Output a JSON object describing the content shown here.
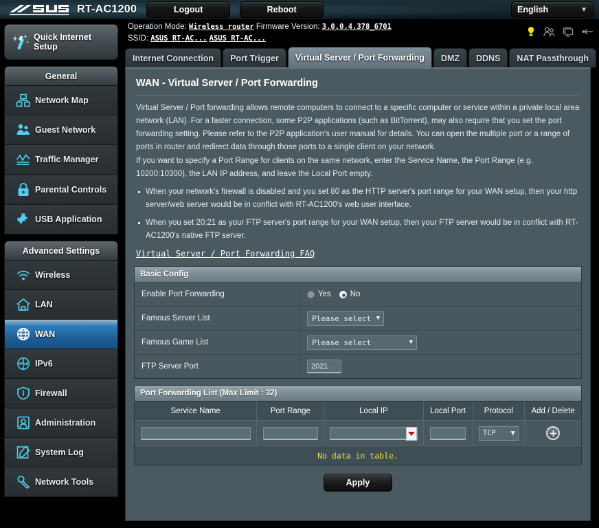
{
  "header": {
    "brand": "ASUS",
    "model": "RT-AC1200",
    "logout_label": "Logout",
    "reboot_label": "Reboot",
    "language": "English",
    "caret": "▼"
  },
  "status": {
    "operation_mode_label": "Operation Mode:",
    "operation_mode_value": "Wireless router",
    "firmware_label": "Firmware Version:",
    "firmware_value": "3.0.0.4.378_6701",
    "ssid_label": "SSID:",
    "ssid_1": "ASUS RT-AC...",
    "ssid_2": "ASUS RT-AC...",
    "icons": [
      "alert-icon",
      "clients-icon",
      "monitor-icon",
      "usb-icon"
    ]
  },
  "sidebar": {
    "quick_setup": "Quick Internet Setup",
    "groups": [
      {
        "title": "General",
        "items": [
          {
            "label": "Network Map",
            "icon": "network-map-icon",
            "active": false
          },
          {
            "label": "Guest Network",
            "icon": "guest-network-icon",
            "active": false
          },
          {
            "label": "Traffic Manager",
            "icon": "traffic-manager-icon",
            "active": false
          },
          {
            "label": "Parental Controls",
            "icon": "parental-controls-icon",
            "active": false
          },
          {
            "label": "USB Application",
            "icon": "usb-application-icon",
            "active": false
          }
        ]
      },
      {
        "title": "Advanced Settings",
        "items": [
          {
            "label": "Wireless",
            "icon": "wireless-icon",
            "active": false
          },
          {
            "label": "LAN",
            "icon": "lan-icon",
            "active": false
          },
          {
            "label": "WAN",
            "icon": "wan-icon",
            "active": true
          },
          {
            "label": "IPv6",
            "icon": "ipv6-icon",
            "active": false
          },
          {
            "label": "Firewall",
            "icon": "firewall-icon",
            "active": false
          },
          {
            "label": "Administration",
            "icon": "administration-icon",
            "active": false
          },
          {
            "label": "System Log",
            "icon": "system-log-icon",
            "active": false
          },
          {
            "label": "Network Tools",
            "icon": "network-tools-icon",
            "active": false
          }
        ]
      }
    ]
  },
  "tabs": [
    {
      "label": "Internet Connection",
      "active": false
    },
    {
      "label": "Port Trigger",
      "active": false
    },
    {
      "label": "Virtual Server / Port Forwarding",
      "active": true
    },
    {
      "label": "DMZ",
      "active": false
    },
    {
      "label": "DDNS",
      "active": false
    },
    {
      "label": "NAT Passthrough",
      "active": false
    }
  ],
  "page": {
    "title": "WAN - Virtual Server / Port Forwarding",
    "desc_p1": "Virtual Server / Port forwarding allows remote computers to connect to a specific computer or service within a private local area network (LAN). For a faster connection, some P2P applications (such as BitTorrent), may also require that you set the port forwarding setting. Please refer to the P2P application's user manual for details. You can open the multiple port or a range of ports in router and redirect data through those ports to a single client on your network.",
    "desc_p2": "If you want to specify a Port Range for clients on the same network, enter the Service Name, the Port Range (e.g. 10200:10300), the LAN IP address, and leave the Local Port empty.",
    "bullet_1": "When your network's firewall is disabled and you set 80 as the HTTP server's port range for your WAN setup, then your http server/web server would be in conflict with RT-AC1200's web user interface.",
    "bullet_2": "When you set 20:21 as your FTP server's port range for your WAN setup, then your FTP server would be in conflict with RT-AC1200's native FTP server.",
    "faq_link": "Virtual Server / Port Forwarding FAQ"
  },
  "basic_config": {
    "section_title": "Basic Config",
    "enable_label": "Enable Port Forwarding",
    "yes_label": "Yes",
    "no_label": "No",
    "enable_selected": "No",
    "famous_server_label": "Famous Server List",
    "famous_server_value": "Please select",
    "famous_game_label": "Famous Game List",
    "famous_game_value": "Please select",
    "ftp_port_label": "FTP Server Port",
    "ftp_port_value": "2021",
    "caret": "▼"
  },
  "port_forwarding_list": {
    "section_title": "Port Forwarding List (Max Limit : 32)",
    "columns": [
      "Service Name",
      "Port Range",
      "Local IP",
      "Local Port",
      "Protocol",
      "Add / Delete"
    ],
    "input_row": {
      "service_name": "",
      "port_range": "",
      "local_ip": "",
      "local_port": "",
      "protocol": "TCP",
      "add_icon": "plus-icon"
    },
    "empty_message": "No data in table.",
    "rows": []
  },
  "footer": {
    "apply_label": "Apply"
  },
  "colors": {
    "accent_blue": "#1d5f99",
    "panel_bg": "#4a5a60",
    "section_head": "#7d8d95",
    "warning_yellow": "#ece03a",
    "dropdown_red": "#c11414"
  }
}
